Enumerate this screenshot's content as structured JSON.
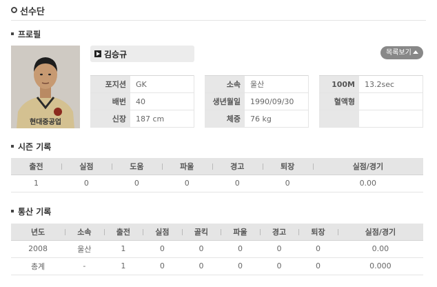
{
  "page_title": "선수단",
  "profile": {
    "heading": "프로필",
    "name": "김승규",
    "list_button": "목록보기",
    "photo_jersey_text": "현대중공업",
    "info_columns": [
      [
        {
          "label": "포지션",
          "value": "GK"
        },
        {
          "label": "배번",
          "value": "40"
        },
        {
          "label": "신장",
          "value": "187 cm"
        }
      ],
      [
        {
          "label": "소속",
          "value": "울산"
        },
        {
          "label": "생년월일",
          "value": "1990/09/30"
        },
        {
          "label": "체중",
          "value": "76 kg"
        }
      ],
      [
        {
          "label": "100M",
          "value": "13.2sec"
        },
        {
          "label": "혈액형",
          "value": ""
        },
        {
          "label": "",
          "value": ""
        }
      ]
    ]
  },
  "season": {
    "heading": "시즌 기록",
    "headers": [
      "출전",
      "실점",
      "도움",
      "파울",
      "경고",
      "퇴장",
      "실점/경기"
    ],
    "rows": [
      [
        "1",
        "0",
        "0",
        "0",
        "0",
        "0",
        "0.00"
      ]
    ]
  },
  "career": {
    "heading": "통산 기록",
    "headers": [
      "년도",
      "소속",
      "출전",
      "실점",
      "골킥",
      "파울",
      "경고",
      "퇴장",
      "실점/경기"
    ],
    "rows": [
      [
        "2008",
        "울산",
        "1",
        "0",
        "0",
        "0",
        "0",
        "0",
        "0.00"
      ],
      [
        "총계",
        "-",
        "1",
        "0",
        "0",
        "0",
        "0",
        "0",
        "0.000"
      ]
    ]
  },
  "colors": {
    "header_bg": "#e5e5e5",
    "button_bg": "#888888",
    "jersey": "#d4c191"
  }
}
